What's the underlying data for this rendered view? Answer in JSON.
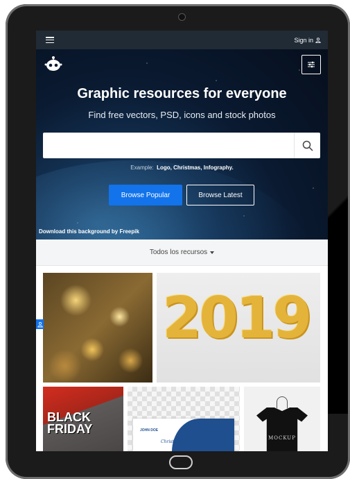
{
  "topbar": {
    "sign_in": "Sign in"
  },
  "hero": {
    "title": "Graphic resources for everyone",
    "subtitle": "Find free vectors, PSD, icons and stock photos",
    "search_placeholder": "",
    "example_label": "Example:",
    "example_links": [
      "Logo",
      "Christmas",
      "Infography"
    ],
    "browse_popular": "Browse Popular",
    "browse_latest": "Browse Latest",
    "credit": "Download this background by Freepik"
  },
  "resources": {
    "filter_label": "Todos los recursos"
  },
  "gallery": {
    "tile_2019_text": "2019",
    "tile_blackfriday_text": "BLACK FRIDAY",
    "tile_card_name": "JOHN DOE",
    "tile_card_script": "Christmas",
    "tile_mockup_text": "MOCKUP"
  },
  "colors": {
    "accent": "#1273eb",
    "topbar": "#212b36"
  }
}
